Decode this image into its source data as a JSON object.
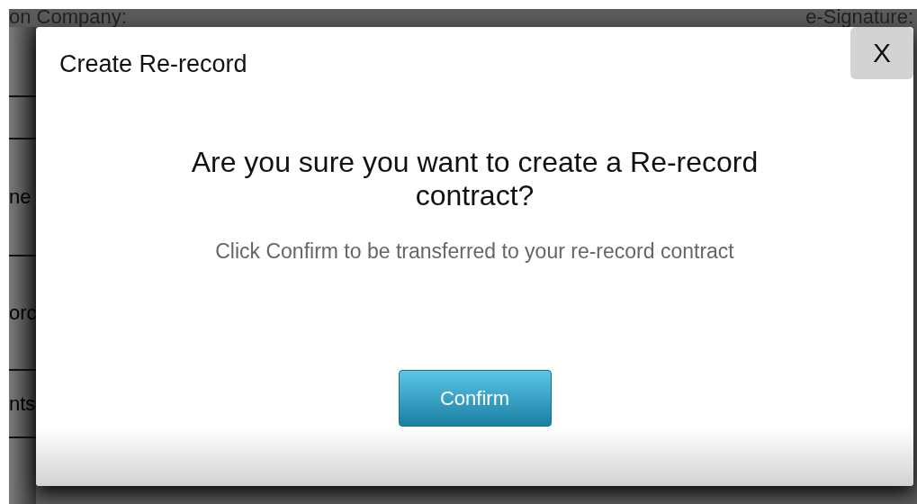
{
  "background": {
    "header_left": "on Company:",
    "header_right": "e-Signature:",
    "labels": [
      "ne",
      "orc",
      "nts"
    ]
  },
  "dialog": {
    "title": "Create Re-record",
    "close": "X",
    "heading": "Are you sure you want to create a Re-record contract?",
    "message": "Click Confirm to be transferred to your re-record contract",
    "buttons": [
      "Confirm"
    ]
  }
}
